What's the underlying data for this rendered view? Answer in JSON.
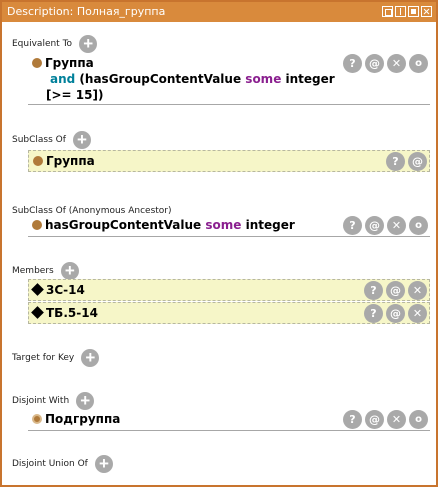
{
  "window": {
    "title": "Description: Полная_группа"
  },
  "sections": {
    "equivalent_to": {
      "label": "Equivalent To"
    },
    "subclass_of": {
      "label": "SubClass Of"
    },
    "subclass_anon": {
      "label": "SubClass Of (Anonymous Ancestor)"
    },
    "members": {
      "label": "Members"
    },
    "target_for_key": {
      "label": "Target for Key"
    },
    "disjoint_with": {
      "label": "Disjoint With"
    },
    "disjoint_union_of": {
      "label": "Disjoint Union Of"
    }
  },
  "equivalent_expr": {
    "class_name": "Группа",
    "and_kw": "and",
    "line2_rest": "(hasGroupContentValue",
    "some_kw": "some",
    "datatype": "integer",
    "line3": "[>= 15])"
  },
  "subclass_item": {
    "label": "Группа"
  },
  "anon_item": {
    "property": "hasGroupContentValue",
    "some_kw": "some",
    "datatype": "integer"
  },
  "members": [
    {
      "label": "3С-14"
    },
    {
      "label": "ТБ.5-14"
    }
  ],
  "disjoint_item": {
    "label": "Подгруппа"
  },
  "actions": {
    "explain": "?",
    "annotate": "@",
    "delete": "✕",
    "edit": "o"
  },
  "icons": {
    "add": "add-icon",
    "class": "class-icon",
    "individual": "individual-icon"
  },
  "colors": {
    "titlebar": "#d98a3c",
    "row_highlight": "#f6f6c8",
    "keyword_and": "#00809a",
    "keyword_some": "#8a1f8f",
    "class_dot": "#b07a3a"
  }
}
